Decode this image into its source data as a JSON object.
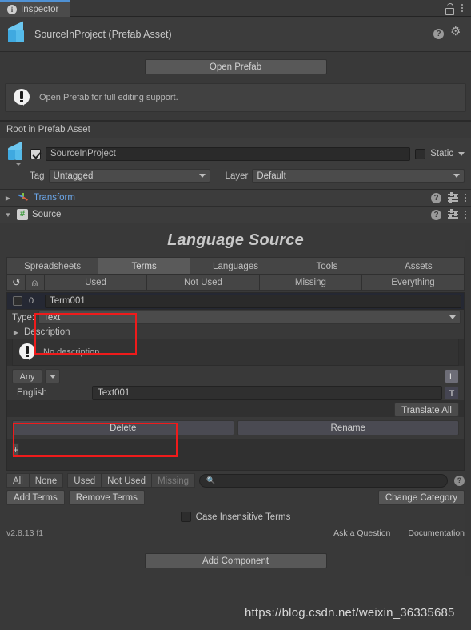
{
  "window": {
    "tab_label": "Inspector",
    "tab_icon": "info-icon",
    "lock_icon": "lock-icon",
    "menu_icon": "kebab-menu-icon"
  },
  "asset_header": {
    "title": "SourceInProject (Prefab Asset)",
    "icon": "prefab-cube-icon",
    "help_icon": "help-icon",
    "settings_icon": "gear-icon"
  },
  "prefab": {
    "open_button": "Open Prefab",
    "info_message": "Open Prefab for full editing support.",
    "info_icon": "info-bubble-icon"
  },
  "root_bar": {
    "label": "Root in Prefab Asset"
  },
  "gameobject": {
    "enabled": true,
    "name": "SourceInProject",
    "static_label": "Static",
    "static_checked": false,
    "tag_label": "Tag",
    "tag_value": "Untagged",
    "layer_label": "Layer",
    "layer_value": "Default"
  },
  "components": [
    {
      "name": "Transform",
      "icon": "transform-axis-icon",
      "expanded": false,
      "style": "blue"
    },
    {
      "name": "Source",
      "icon": "script-hash-icon",
      "expanded": true,
      "style": "plain"
    }
  ],
  "language_source": {
    "title": "Language Source",
    "tabs": [
      {
        "label": "Spreadsheets",
        "active": false
      },
      {
        "label": "Terms",
        "active": true
      },
      {
        "label": "Languages",
        "active": false
      },
      {
        "label": "Tools",
        "active": false
      },
      {
        "label": "Assets",
        "active": false
      }
    ],
    "filters": {
      "refresh_icon": "refresh-icon",
      "upload_icon": "upload-icon",
      "buttons": [
        "Used",
        "Not Used",
        "Missing",
        "Everything"
      ]
    },
    "term": {
      "checked": false,
      "index": "0",
      "name": "Term001",
      "type_label": "Type:",
      "type_value": "Text",
      "description_label": "Description",
      "description_placeholder": "No description",
      "description_icon": "info-bubble-icon",
      "any_label": "Any",
      "any_dropdown_icon": "chevron-down-icon",
      "lang_button": "L",
      "text_button": "T",
      "language_name": "English",
      "language_value": "Text001",
      "translate_all": "Translate All",
      "delete_button": "Delete",
      "rename_button": "Rename",
      "add_row_button": "+"
    },
    "bottom": {
      "select_filters": [
        "All",
        "None",
        "Used",
        "Not Used",
        "Missing"
      ],
      "missing_disabled": true,
      "search_value": "",
      "search_placeholder": "",
      "search_icon": "search-icon",
      "help_icon": "help-icon",
      "add_terms": "Add Terms",
      "remove_terms": "Remove Terms",
      "change_category": "Change Category",
      "case_insensitive_label": "Case Insensitive Terms",
      "case_insensitive_checked": false,
      "version": "v2.8.13 f1",
      "ask_question": "Ask a Question",
      "documentation": "Documentation"
    }
  },
  "footer": {
    "add_component": "Add Component",
    "watermark": "https://blog.csdn.net/weixin_36335685"
  },
  "annotations": {
    "accent_color": "#ef1b1b"
  }
}
